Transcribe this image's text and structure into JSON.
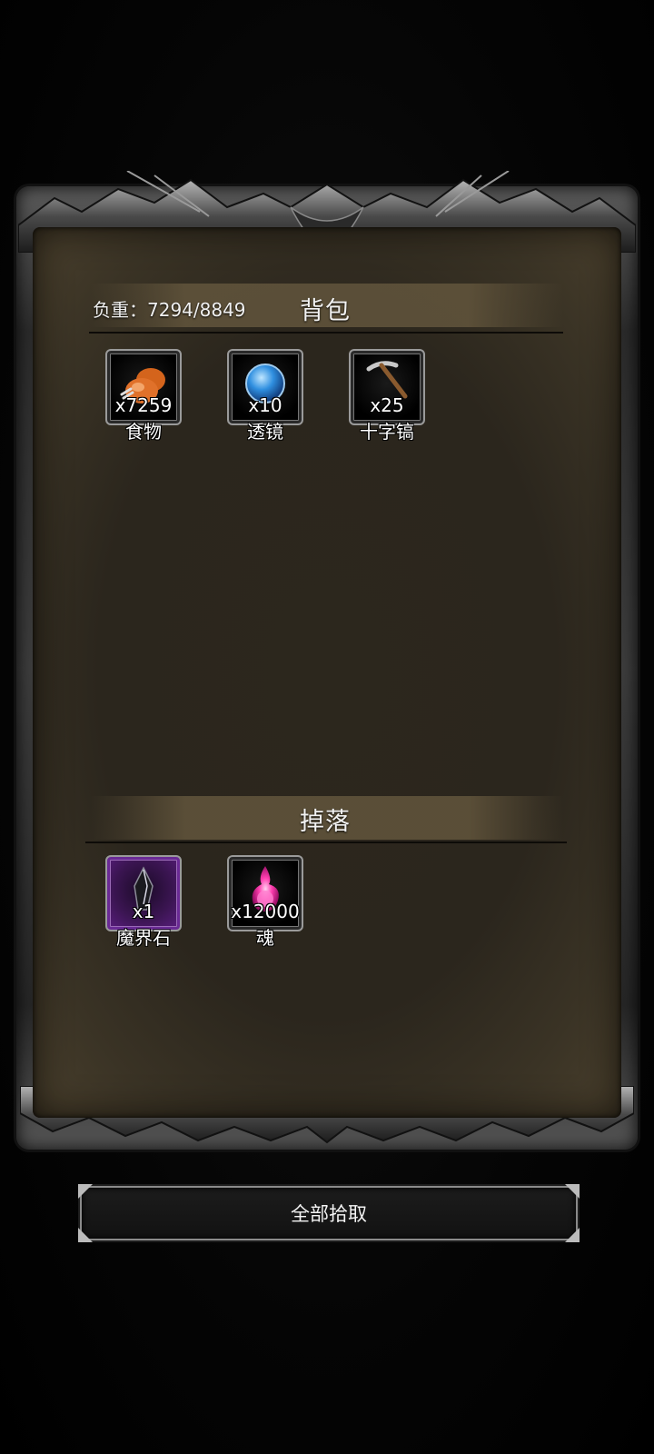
{
  "backpack": {
    "title": "背包",
    "weight_label": "负重：7294/8849",
    "items": [
      {
        "name": "食物",
        "qty": "x7259",
        "icon": "food-icon"
      },
      {
        "name": "透镜",
        "qty": "x10",
        "icon": "lens-icon"
      },
      {
        "name": "十字镐",
        "qty": "x25",
        "icon": "pickaxe-icon"
      }
    ]
  },
  "drops": {
    "title": "掉落",
    "items": [
      {
        "name": "魔界石",
        "qty": "x1",
        "icon": "demon-stone-icon",
        "rarity_color": "#5c1e82"
      },
      {
        "name": "魂",
        "qty": "x12000",
        "icon": "soul-icon"
      }
    ]
  },
  "pickup_button": {
    "label": "全部拾取"
  },
  "colors": {
    "parchment": "#2c271d",
    "section_bar": "#62553c",
    "frame": "#3d3d3d"
  }
}
